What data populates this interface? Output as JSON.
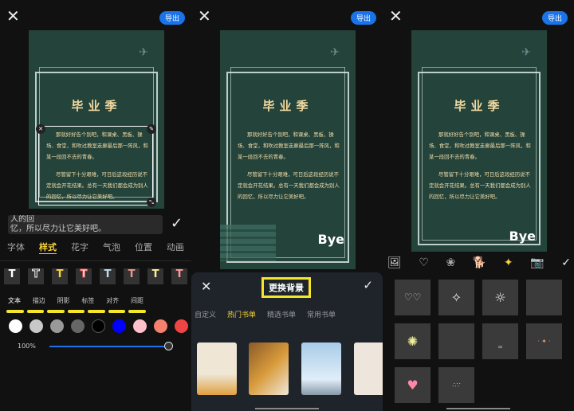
{
  "export_label": "导出",
  "poster": {
    "title": "毕业季",
    "para1": "那就好好告个别吧，和课桌、黑板、操场、食堂，和吹过教室走廊最后那一阵风，和某一段回不去的青春。",
    "para2": "尽管留下十分艰难，可日后这段经历说不定就会开花结果。总有一天我们都会成为别人的回忆，所以尽力让它美好吧。",
    "bye": "Bye"
  },
  "editor": {
    "input_value": "人的回\n忆，所以尽力让它美好吧。",
    "tabs": [
      "字体",
      "样式",
      "花字",
      "气泡",
      "位置",
      "动画"
    ],
    "active_tab": 1,
    "style_presets": [
      "T",
      "T",
      "T",
      "T",
      "T",
      "T",
      "T",
      "T"
    ],
    "sub_tabs": [
      "文本",
      "描边",
      "阴影",
      "标签",
      "对齐",
      "间距"
    ],
    "colors": [
      "#ffffff",
      "#c8c8c8",
      "#999999",
      "#666666",
      "#000000",
      "#0000ff",
      "#ffc0cb",
      "#f4806e",
      "#ef4444"
    ],
    "opacity_label": "100%",
    "opacity_value": 1.0
  },
  "background": {
    "title": "更换背景",
    "tabs": [
      "自定义",
      "热门书单",
      "精选书单",
      "常用书单"
    ],
    "active_tab": 1
  },
  "stickers": {
    "categories": [
      "image-icon",
      "heart-icon",
      "photo-sticker-icon",
      "dog-icon",
      "sparkle-icon",
      "camera-icon"
    ],
    "active_category": 4
  }
}
